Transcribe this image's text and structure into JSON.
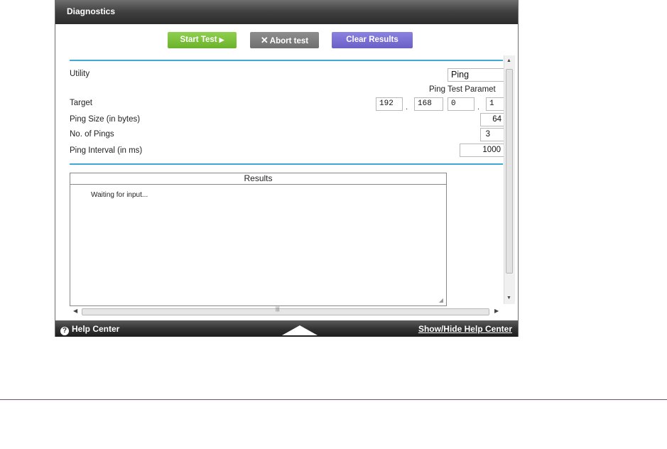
{
  "window": {
    "title": "Diagnostics"
  },
  "toolbar": {
    "start_label": "Start Test",
    "abort_label": "Abort test",
    "clear_label": "Clear Results"
  },
  "form": {
    "utility_label": "Utility",
    "utility_value": "Ping",
    "params_header": "Ping Test Paramet",
    "target_label": "Target",
    "target_octets": [
      "192",
      "168",
      "0",
      "1"
    ],
    "ping_size_label": "Ping Size (in bytes)",
    "ping_size_value": "64",
    "num_pings_label": "No. of Pings",
    "num_pings_value": "3",
    "interval_label": "Ping Interval (in ms)",
    "interval_value": "1000"
  },
  "results": {
    "header": "Results",
    "text": "Waiting for input..."
  },
  "footer": {
    "help_label": "Help Center",
    "toggle_label": "Show/Hide Help Center"
  },
  "colors": {
    "accent_rule": "#40a9d8",
    "start_green": "#6bb22c",
    "abort_gray": "#6f6f6f",
    "clear_purple": "#6a5fc6"
  }
}
